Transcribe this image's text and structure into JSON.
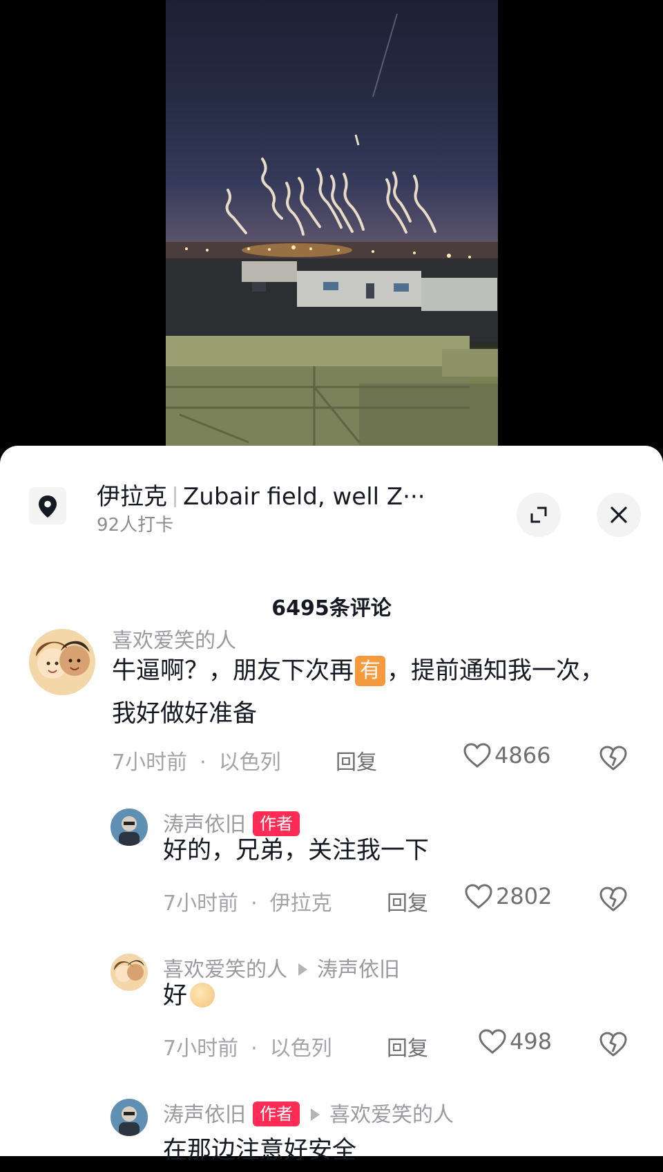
{
  "location": {
    "name": "伊拉克",
    "place": "Zubair field, well Z···",
    "checkins": "92人打卡",
    "icon": "location-pin-icon"
  },
  "comments_header": "6495条评论",
  "comments": [
    {
      "author": "喜欢爱笑的人",
      "text_before_emoji": "牛逼啊？，朋友下次再",
      "emoji_text": "有",
      "text_after_emoji": "，提前通知我一次，我好做好准备",
      "time": "7小时前",
      "region": "以色列",
      "reply": "回复",
      "likes": "4866"
    },
    {
      "author": "涛声依旧",
      "badge": "作者",
      "text": "好的，兄弟，关注我一下",
      "time": "7小时前",
      "region": "伊拉克",
      "reply": "回复",
      "likes": "2802"
    },
    {
      "author": "喜欢爱笑的人",
      "reply_to": "涛声依旧",
      "text": "好",
      "time": "7小时前",
      "region": "以色列",
      "reply": "回复",
      "likes": "498"
    },
    {
      "author": "涛声依旧",
      "badge": "作者",
      "reply_to": "喜欢爱笑的人",
      "text": "在那边注意好安全"
    }
  ],
  "colors": {
    "accent": "#fe2c55",
    "text": "#161823",
    "muted": "#a3a3a8"
  }
}
